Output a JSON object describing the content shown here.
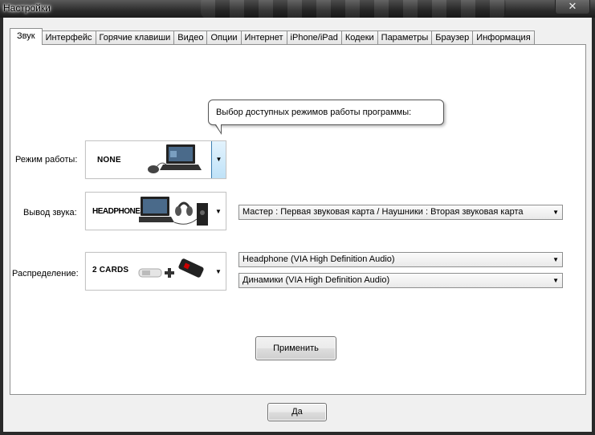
{
  "window": {
    "title": "Настройки",
    "close_glyph": "✕"
  },
  "tabs": [
    {
      "label": "Звук",
      "active": true
    },
    {
      "label": "Интерфейс"
    },
    {
      "label": "Горячие клавиши"
    },
    {
      "label": "Видео"
    },
    {
      "label": "Опции"
    },
    {
      "label": "Интернет"
    },
    {
      "label": "iPhone/iPad"
    },
    {
      "label": "Кодеки"
    },
    {
      "label": "Параметры"
    },
    {
      "label": "Браузер"
    },
    {
      "label": "Информация"
    }
  ],
  "tooltip": {
    "text": "Выбор доступных режимов работы программы:"
  },
  "mode": {
    "label": "Режим работы:",
    "value": "NONE",
    "icon": "laptop-mouse-icon"
  },
  "output": {
    "label": "Вывод звука:",
    "value": "HEADPHONES",
    "icon": "laptop-headphones-icon",
    "combo": "Мастер : Первая звуковая карта / Наушники : Вторая звуковая карта"
  },
  "distribution": {
    "label": "Распределение:",
    "value": "2 CARDS",
    "icon": "two-soundcards-icon",
    "combo1": "Headphone (VIA High Definition Audio)",
    "combo2": "Динамики (VIA High Definition Audio)"
  },
  "buttons": {
    "apply": "Применить",
    "ok": "Да"
  },
  "dropdown_glyph": "▼"
}
